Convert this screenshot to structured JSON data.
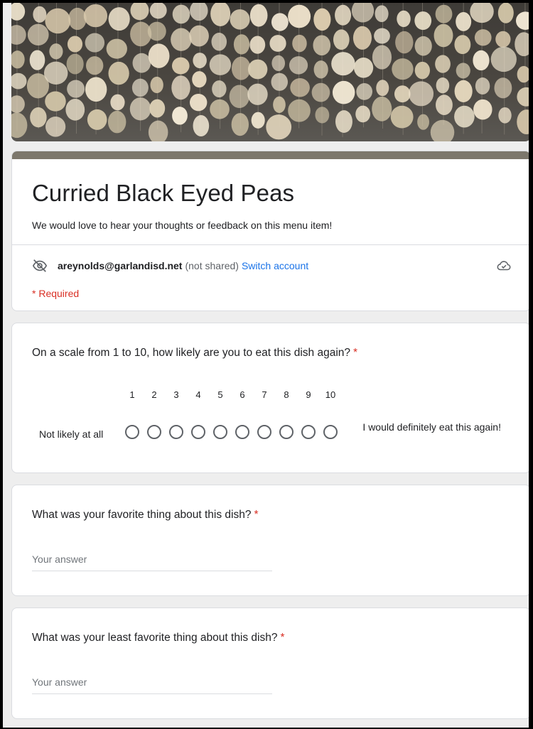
{
  "form": {
    "title": "Curried Black Eyed Peas",
    "description": "We would love to hear your thoughts or feedback on this menu item!",
    "account_email": "areynolds@garlandisd.net",
    "account_not_shared": "(not shared)",
    "switch_account": "Switch account",
    "required_note": "* Required"
  },
  "questions": [
    {
      "title": "On a scale from 1 to 10, how likely are you to eat this dish again?",
      "required_mark": "*",
      "scale": [
        "1",
        "2",
        "3",
        "4",
        "5",
        "6",
        "7",
        "8",
        "9",
        "10"
      ],
      "low_label": "Not likely at all",
      "high_label": "I would definitely eat this again!"
    },
    {
      "title": "What was your favorite thing about this dish?",
      "required_mark": "*",
      "placeholder": "Your answer"
    },
    {
      "title": "What was your least favorite thing about this dish?",
      "required_mark": "*",
      "placeholder": "Your answer"
    }
  ],
  "icons": {
    "account": "eye-off-icon",
    "sync": "cloud-check-icon"
  },
  "colors": {
    "theme_bar": "#7c776c",
    "required": "#d93025",
    "link": "#1a73e8"
  }
}
